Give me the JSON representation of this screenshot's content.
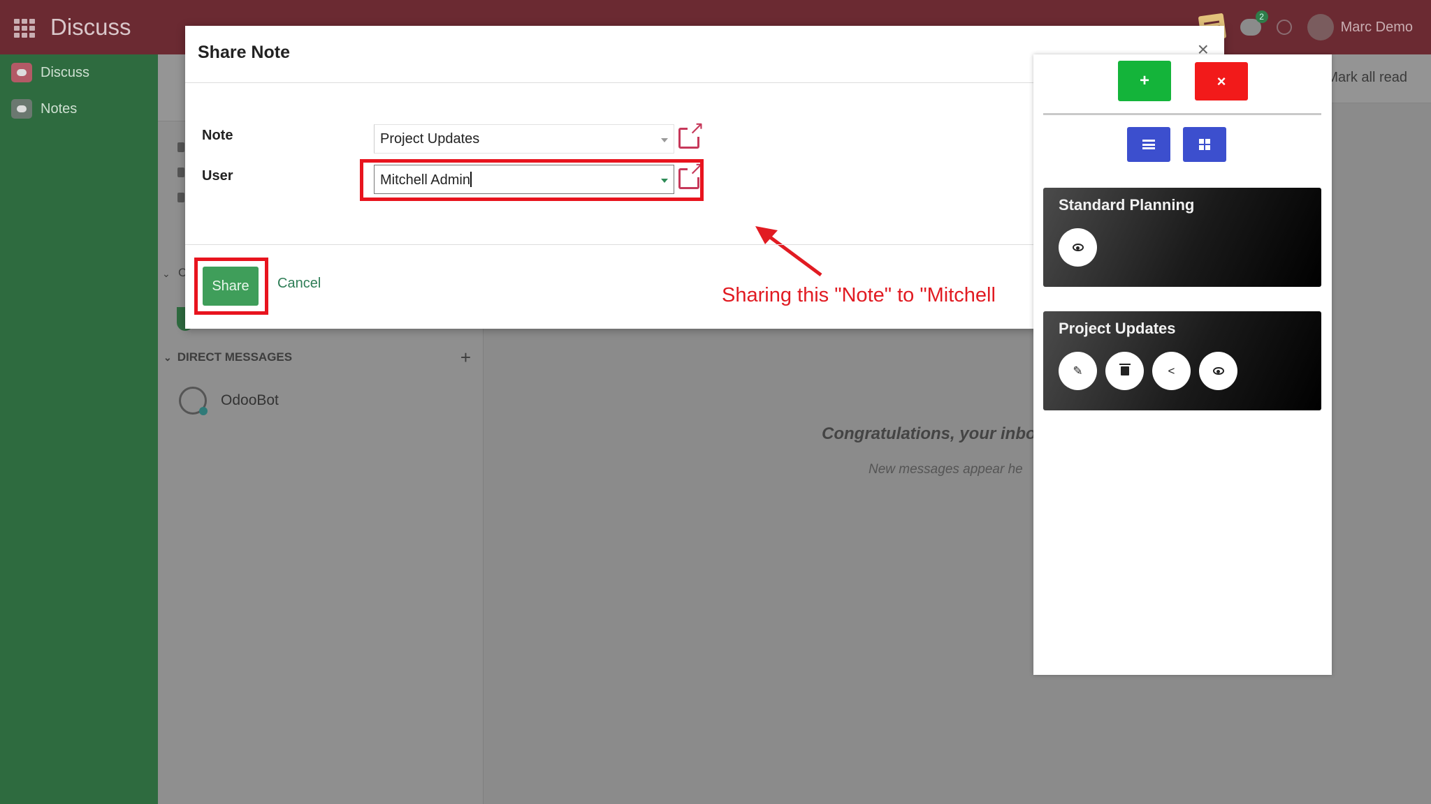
{
  "app": {
    "title": "Discuss"
  },
  "navbar": {
    "user_name": "Marc Demo",
    "chat_count": "2"
  },
  "sidebar": {
    "items": [
      {
        "label": "Discuss"
      },
      {
        "label": "Notes"
      }
    ]
  },
  "discuss": {
    "channels_letter": "C",
    "direct_messages_label": "DIRECT MESSAGES",
    "contacts": [
      {
        "name": "OdooBot"
      }
    ],
    "mark_all_read": "Mark all read",
    "empty_title": "Congratulations, your inbox i",
    "empty_subtitle": "New messages appear he"
  },
  "modal": {
    "title": "Share Note",
    "close_glyph": "×",
    "note_label": "Note",
    "note_value": "Project Updates",
    "user_label": "User",
    "user_value": "Mitchell Admin",
    "share_label": "Share",
    "cancel_label": "Cancel",
    "annotation": "Sharing this \"Note\" to \"Mitchell"
  },
  "panel": {
    "add_glyph": "+",
    "remove_glyph": "×",
    "cards": [
      {
        "title": "Standard Planning"
      },
      {
        "title": "Project Updates"
      }
    ]
  },
  "colors": {
    "navbar": "#6b2a32",
    "sidebar": "#2e6b3f",
    "highlight_red": "#e8141e",
    "add_green": "#14b43a",
    "remove_red": "#f21a1a",
    "view_blue": "#3c4fce"
  }
}
